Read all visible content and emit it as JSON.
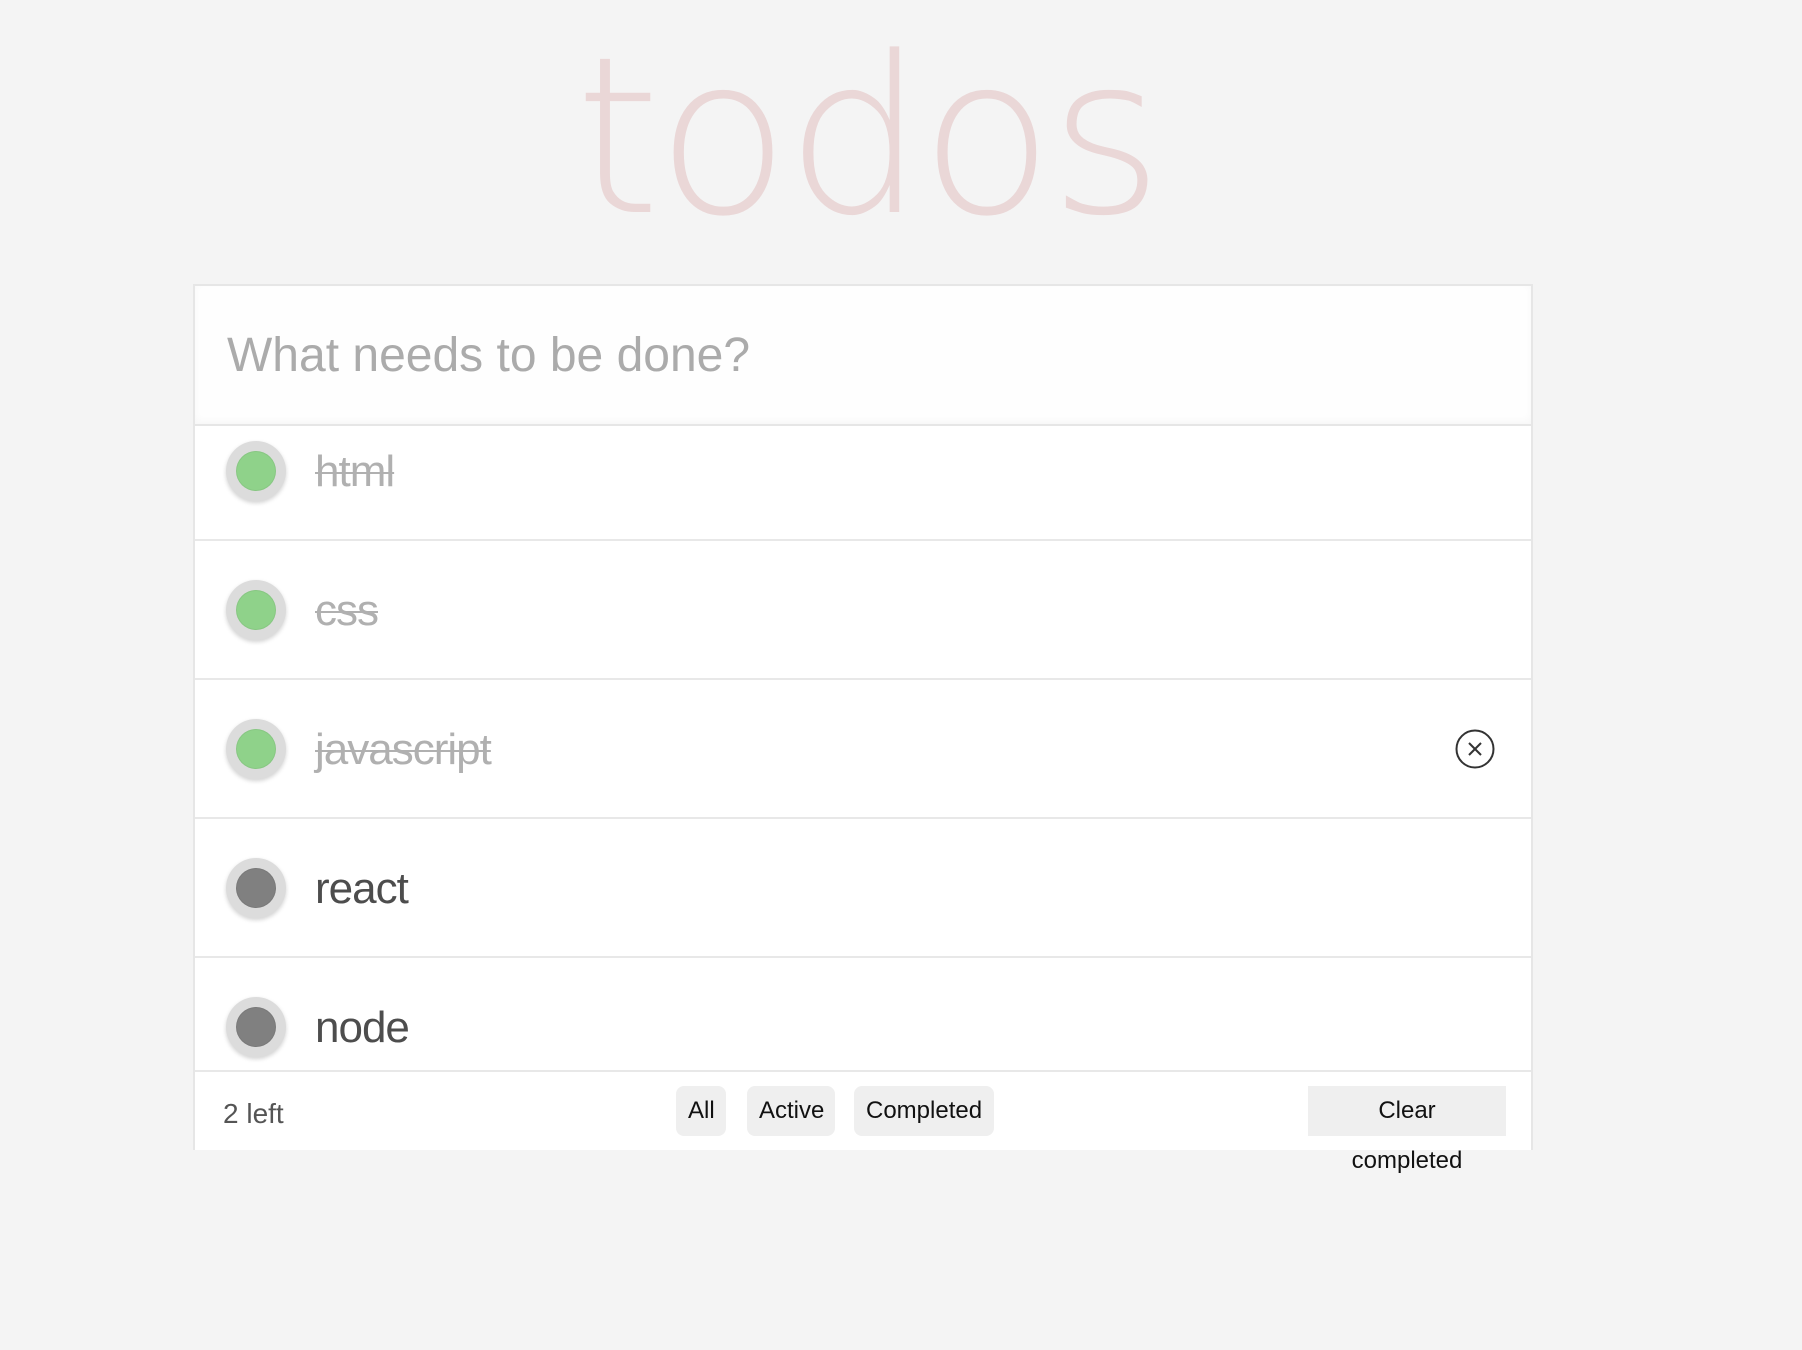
{
  "header": {
    "title": "todos"
  },
  "new_todo": {
    "placeholder": "What needs to be done?"
  },
  "todos": [
    {
      "title": "html",
      "completed": true
    },
    {
      "title": "css",
      "completed": true
    },
    {
      "title": "javascript",
      "completed": true
    },
    {
      "title": "react",
      "completed": false
    },
    {
      "title": "node",
      "completed": false
    }
  ],
  "footer": {
    "count_text": "2 left",
    "filters": {
      "all": "All",
      "active": "Active",
      "completed": "Completed"
    },
    "clear_completed": "Clear completed"
  },
  "colors": {
    "title": "#ead7d7",
    "completed_dot": "#8fd28a",
    "active_dot": "#808080",
    "background": "#f4f4f4"
  },
  "icons": {
    "destroy": "close-circle-icon"
  }
}
